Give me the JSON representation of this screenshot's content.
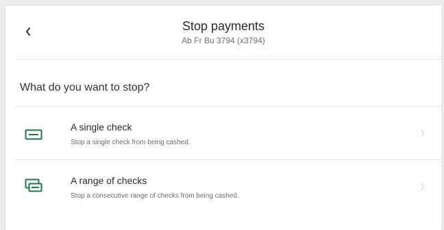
{
  "header": {
    "title": "Stop payments",
    "subtitle": "Ab Fr Bu 3794 (x3794)",
    "back_icon": "chevron-left-icon"
  },
  "prompt": {
    "question": "What do you want to stop?"
  },
  "options": [
    {
      "title": "A single check",
      "description": "Stop a single check from being cashed.",
      "icon": "single-check-icon"
    },
    {
      "title": "A range of checks",
      "description": "Stop a consecutive range of checks from being cashed.",
      "icon": "multiple-checks-icon"
    }
  ],
  "colors": {
    "accent": "#1d7a46",
    "divider": "#e6e6e6",
    "chevron": "#dcdcdc"
  }
}
